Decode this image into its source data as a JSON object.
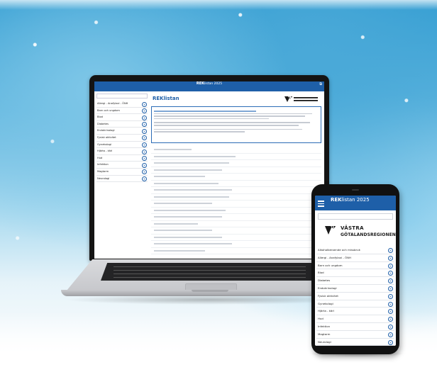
{
  "laptop": {
    "header": {
      "brand_bold": "REK",
      "brand_light": "listan 2025"
    },
    "sidebar_items": [
      "Allergi - Anafylaxi - ÖNH",
      "Barn och ungdom",
      "Blod",
      "Diabetes",
      "Endokrinologi",
      "Fysisk aktivitet",
      "Gynekologi",
      "Hjärta - kärl",
      "Hud",
      "Infektion",
      "Magtarm",
      "Neurologi"
    ],
    "main": {
      "title": "REKlistan"
    }
  },
  "phone": {
    "header": {
      "brand_bold": "REK",
      "brand_light": "listan 2025"
    },
    "logo": {
      "line1": "VÄSTRA",
      "line2": "GÖTALANDSREGIONEN"
    },
    "list_items": [
      "Alkoholberoende och missbruk",
      "Allergi - Anafylaxi - ÖNH",
      "Barn och ungdom",
      "Blod",
      "Diabetes",
      "Endokrinologi",
      "Fysisk aktivitet",
      "Gynekologi",
      "Hjärta - kärl",
      "Hud",
      "Infektion",
      "Magtarm",
      "Neurologi"
    ]
  }
}
